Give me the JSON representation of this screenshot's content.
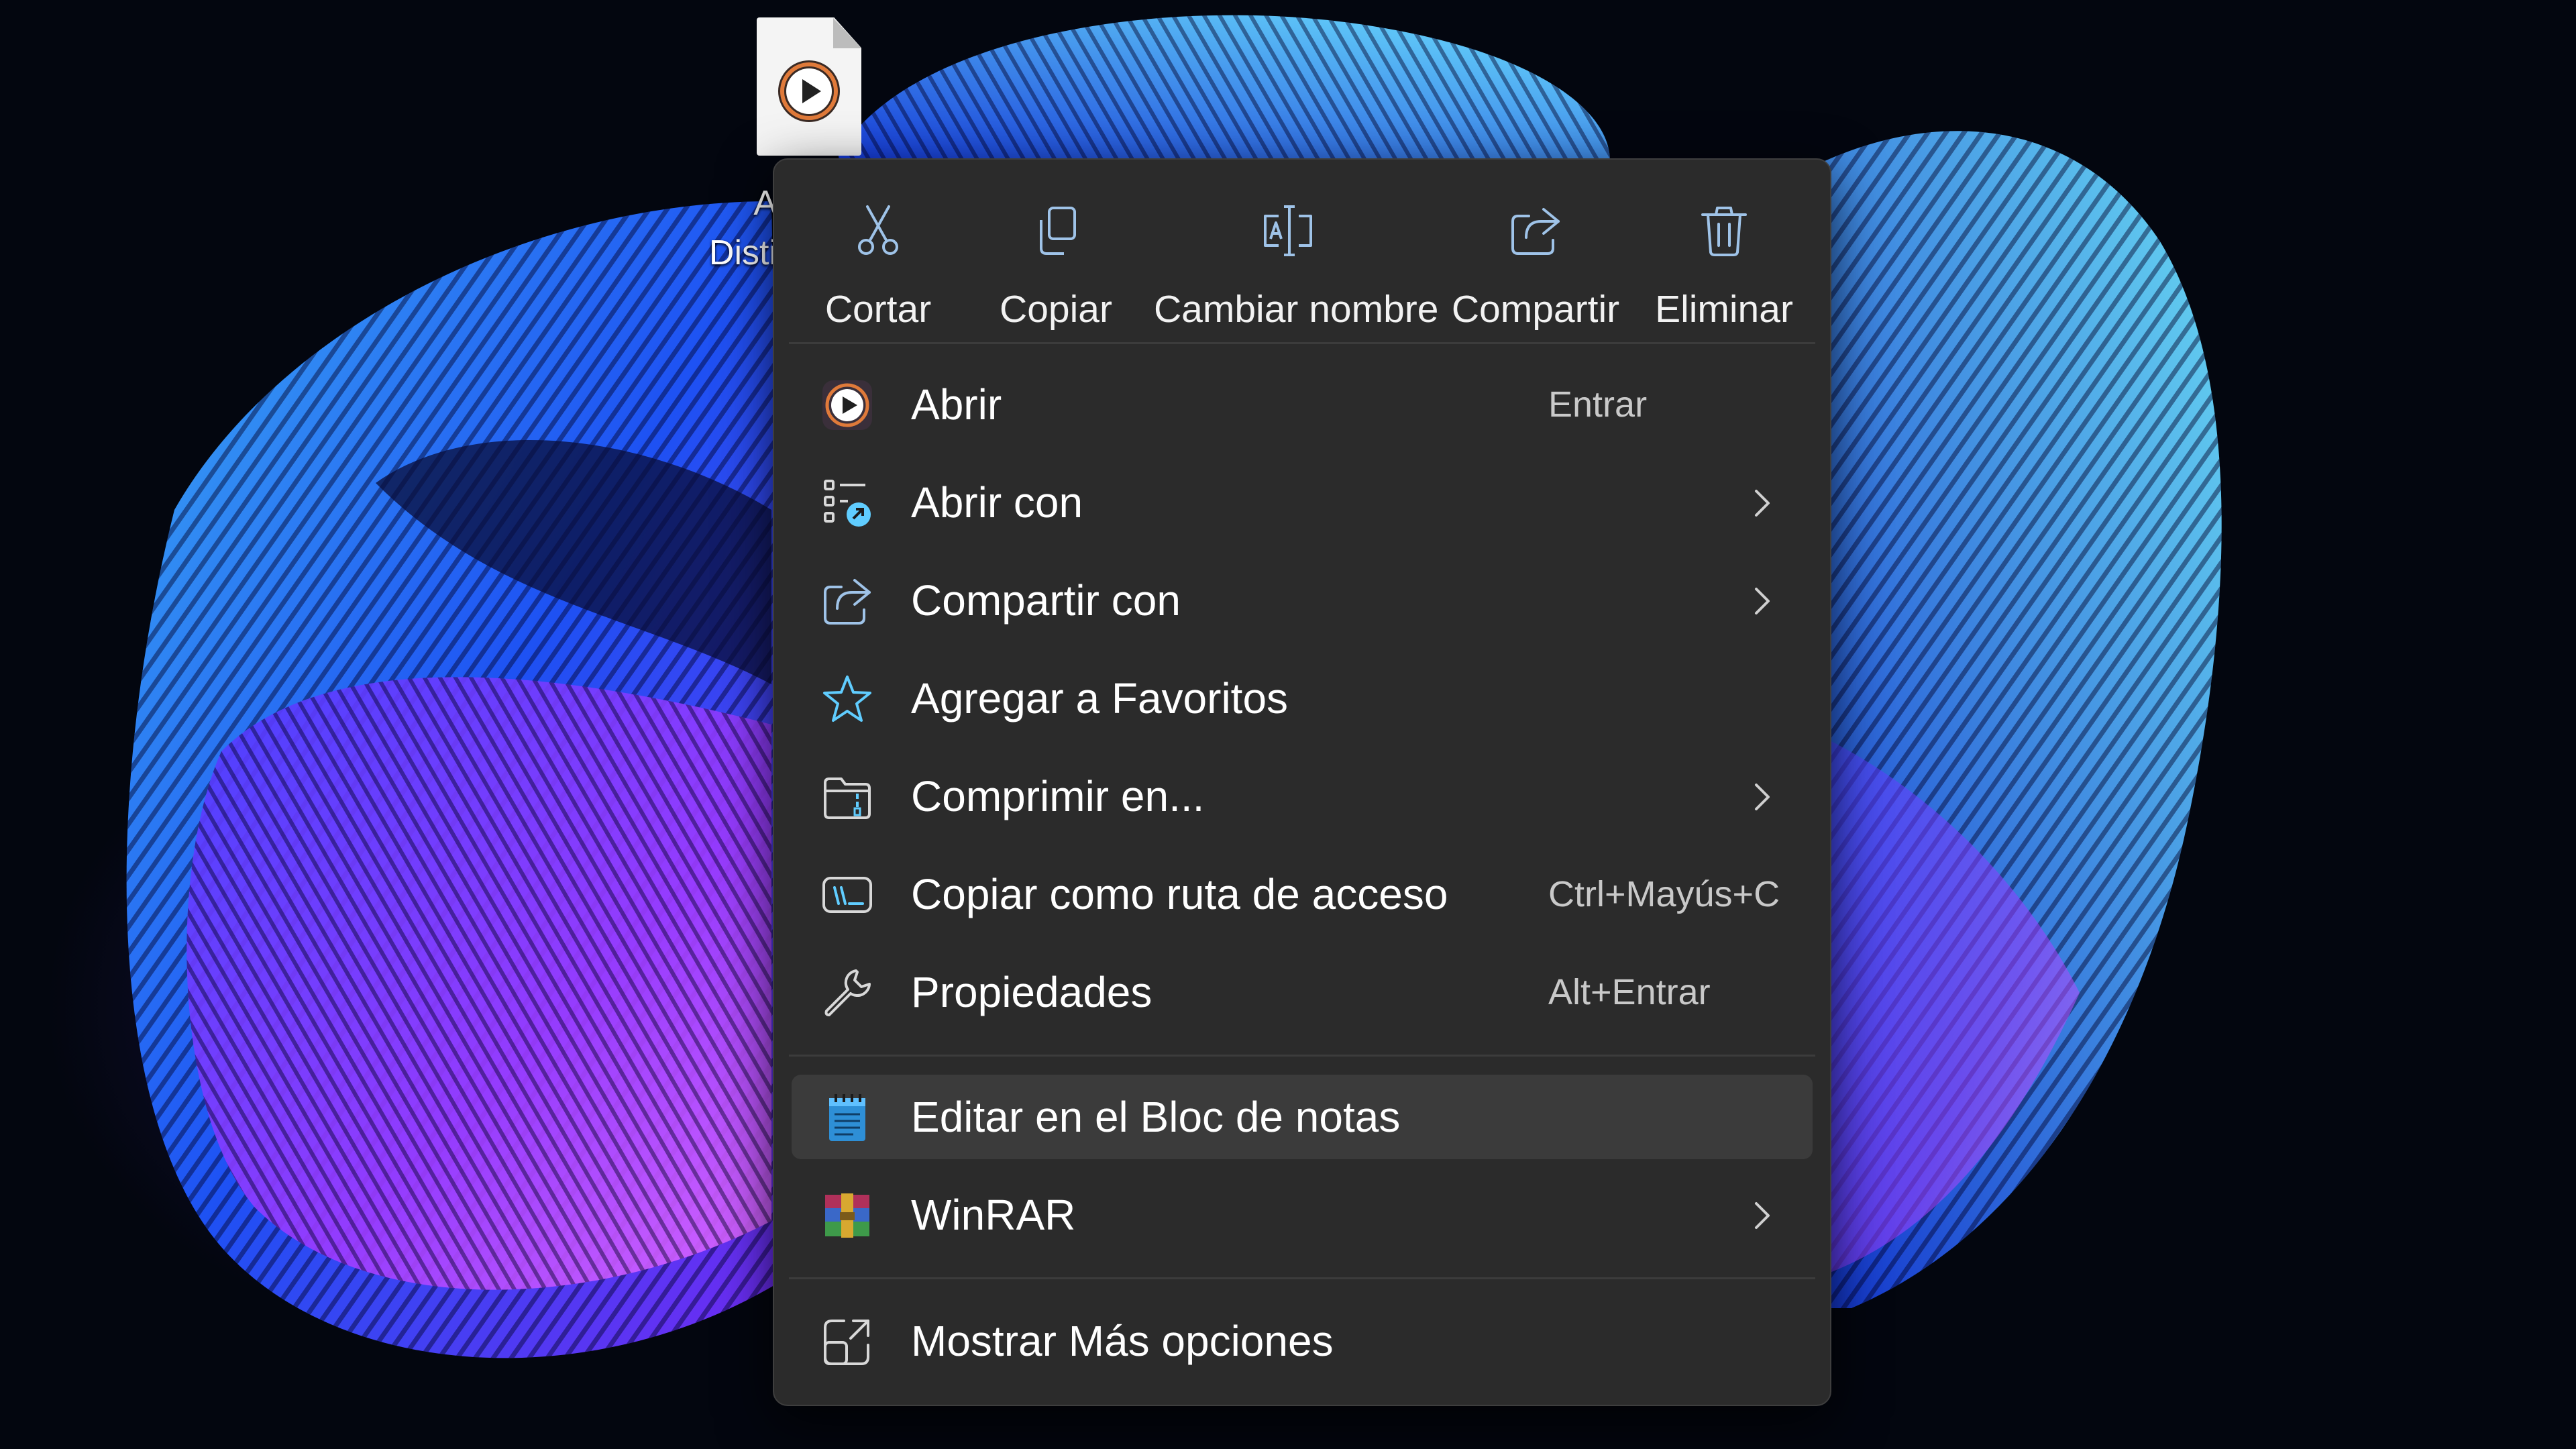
{
  "desktop": {
    "file_icon": "media-player-file-icon",
    "label_fragments": [
      "A",
      "Disti"
    ]
  },
  "toolbar": [
    {
      "label": "Cortar",
      "icon": "scissors-icon"
    },
    {
      "label": "Copiar",
      "icon": "copy-icon"
    },
    {
      "label": "Cambiar nombre",
      "icon": "rename-icon"
    },
    {
      "label": "Compartir",
      "icon": "share-icon"
    },
    {
      "label": "Eliminar",
      "icon": "trash-icon"
    }
  ],
  "items": [
    {
      "label": "Abrir",
      "shortcut": "Entrar",
      "icon": "media-player-icon",
      "submenu": false
    },
    {
      "label": "Abrir con",
      "shortcut": "",
      "icon": "open-with-icon",
      "submenu": true
    },
    {
      "label": "Compartir con",
      "shortcut": "",
      "icon": "share-icon",
      "submenu": true
    },
    {
      "label": "Agregar a Favoritos",
      "shortcut": "",
      "icon": "star-icon",
      "submenu": false
    },
    {
      "label": "Comprimir en...",
      "shortcut": "",
      "icon": "zip-folder-icon",
      "submenu": true
    },
    {
      "label": "Copiar como ruta de acceso",
      "shortcut": "Ctrl+Mayús+C",
      "icon": "copy-path-icon",
      "submenu": false
    },
    {
      "label": "Propiedades",
      "shortcut": "Alt+Entrar",
      "icon": "wrench-icon",
      "submenu": false
    },
    {
      "label": "Editar en el Bloc de notas",
      "shortcut": "",
      "icon": "notepad-icon",
      "submenu": false,
      "highlighted": true
    },
    {
      "label": "WinRAR",
      "shortcut": "",
      "icon": "winrar-icon",
      "submenu": true
    },
    {
      "label": "Mostrar Más opciones",
      "shortcut": "",
      "icon": "more-options-icon",
      "submenu": false
    }
  ],
  "colors": {
    "menu_bg": "#2b2b2b",
    "accent": "#60cdff",
    "highlight": "#3b3b3b",
    "text": "#ffffff",
    "shortcut_text": "#c9c9c9"
  }
}
